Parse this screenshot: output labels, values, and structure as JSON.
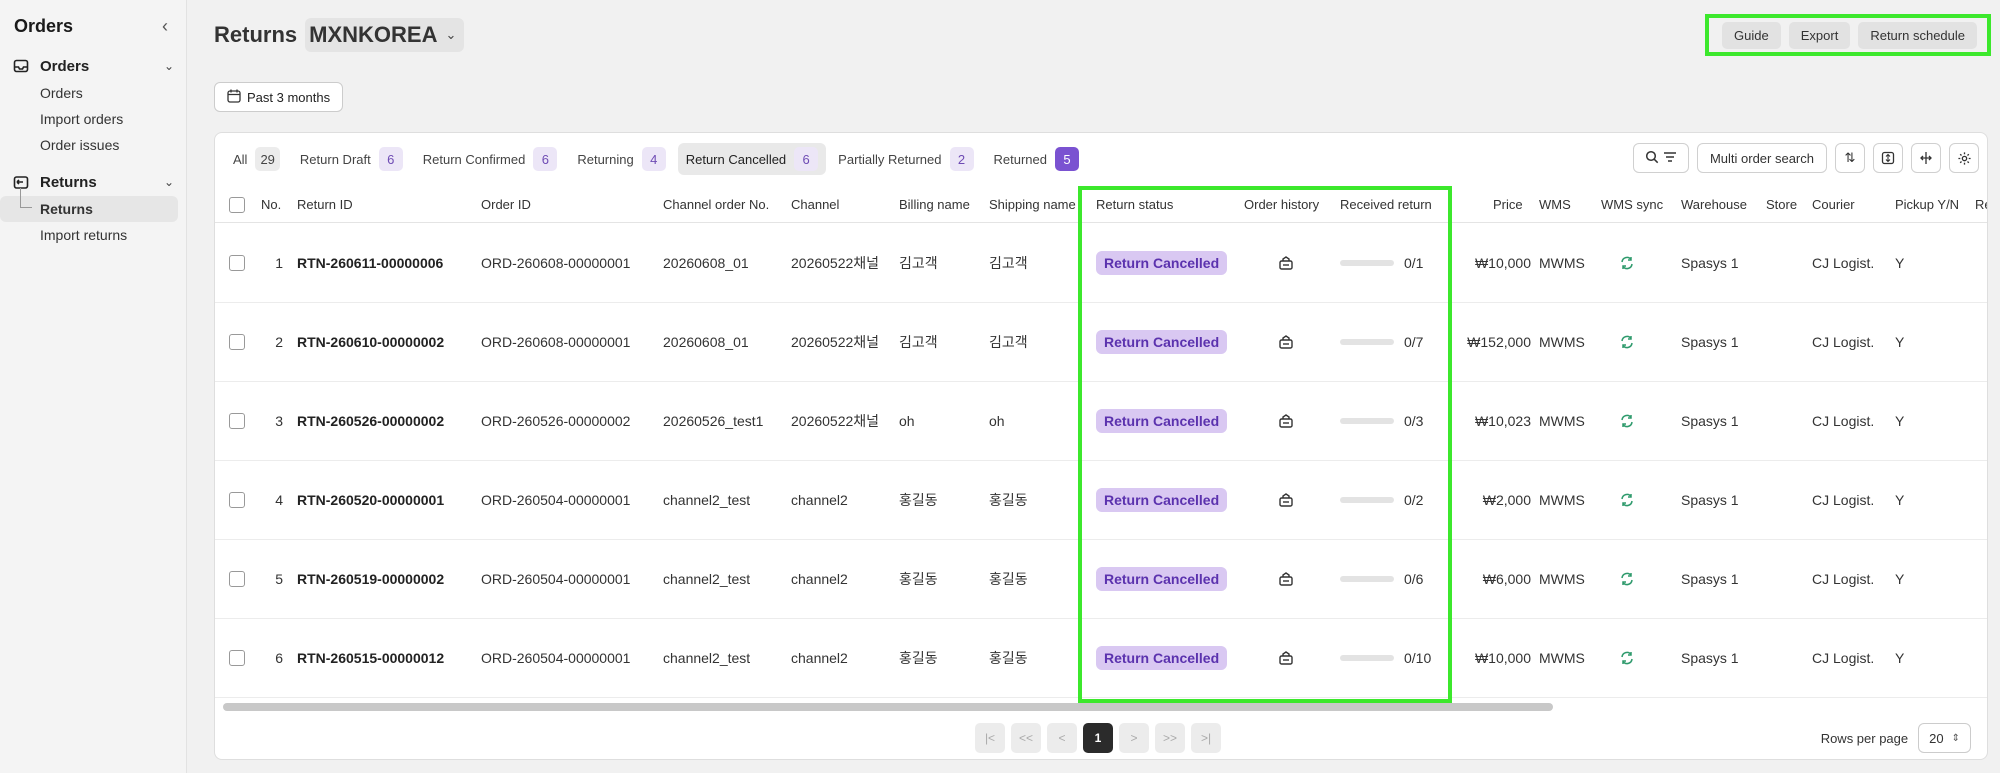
{
  "sidebar": {
    "title": "Orders",
    "sections": [
      {
        "label": "Orders",
        "items": [
          "Orders",
          "Import orders",
          "Order issues"
        ]
      },
      {
        "label": "Returns",
        "items": [
          "Returns",
          "Import returns"
        ]
      }
    ]
  },
  "header": {
    "title": "Returns",
    "store": "MXNKOREA",
    "actions": [
      "Guide",
      "Export",
      "Return schedule"
    ],
    "date_filter": "Past 3 months"
  },
  "tabs": [
    {
      "label": "All",
      "count": "29"
    },
    {
      "label": "Return Draft",
      "count": "6"
    },
    {
      "label": "Return Confirmed",
      "count": "6"
    },
    {
      "label": "Returning",
      "count": "4"
    },
    {
      "label": "Return Cancelled",
      "count": "6"
    },
    {
      "label": "Partially Returned",
      "count": "2"
    },
    {
      "label": "Returned",
      "count": "5"
    }
  ],
  "tools": {
    "multi_search": "Multi order search"
  },
  "columns": [
    "No.",
    "Return ID",
    "Order ID",
    "Channel order No.",
    "Channel",
    "Billing name",
    "Shipping name",
    "Return status",
    "Order history",
    "Received return",
    "Price",
    "WMS",
    "WMS sync",
    "Warehouse",
    "Store",
    "Courier",
    "Pickup Y/N",
    "Re"
  ],
  "rows": [
    {
      "no": "1",
      "return_id": "RTN-260611-00000006",
      "order_id": "ORD-260608-00000001",
      "channel_order": "20260608_01",
      "channel": "20260522채널",
      "billing": "김고객",
      "shipping": "김고객",
      "status": "Return Cancelled",
      "received": "0/1",
      "price": "₩10,000",
      "wms": "MWMS",
      "warehouse": "Spasys 1",
      "courier": "CJ Logist.",
      "pickup": "Y"
    },
    {
      "no": "2",
      "return_id": "RTN-260610-00000002",
      "order_id": "ORD-260608-00000001",
      "channel_order": "20260608_01",
      "channel": "20260522채널",
      "billing": "김고객",
      "shipping": "김고객",
      "status": "Return Cancelled",
      "received": "0/7",
      "price": "₩152,000",
      "wms": "MWMS",
      "warehouse": "Spasys 1",
      "courier": "CJ Logist.",
      "pickup": "Y"
    },
    {
      "no": "3",
      "return_id": "RTN-260526-00000002",
      "order_id": "ORD-260526-00000002",
      "channel_order": "20260526_test1",
      "channel": "20260522채널",
      "billing": "oh",
      "shipping": "oh",
      "status": "Return Cancelled",
      "received": "0/3",
      "price": "₩10,023",
      "wms": "MWMS",
      "warehouse": "Spasys 1",
      "courier": "CJ Logist.",
      "pickup": "Y"
    },
    {
      "no": "4",
      "return_id": "RTN-260520-00000001",
      "order_id": "ORD-260504-00000001",
      "channel_order": "channel2_test",
      "channel": "channel2",
      "billing": "홍길동",
      "shipping": "홍길동",
      "status": "Return Cancelled",
      "received": "0/2",
      "price": "₩2,000",
      "wms": "MWMS",
      "warehouse": "Spasys 1",
      "courier": "CJ Logist.",
      "pickup": "Y"
    },
    {
      "no": "5",
      "return_id": "RTN-260519-00000002",
      "order_id": "ORD-260504-00000001",
      "channel_order": "channel2_test",
      "channel": "channel2",
      "billing": "홍길동",
      "shipping": "홍길동",
      "status": "Return Cancelled",
      "received": "0/6",
      "price": "₩6,000",
      "wms": "MWMS",
      "warehouse": "Spasys 1",
      "courier": "CJ Logist.",
      "pickup": "Y"
    },
    {
      "no": "6",
      "return_id": "RTN-260515-00000012",
      "order_id": "ORD-260504-00000001",
      "channel_order": "channel2_test",
      "channel": "channel2",
      "billing": "홍길동",
      "shipping": "홍길동",
      "status": "Return Cancelled",
      "received": "0/10",
      "price": "₩10,000",
      "wms": "MWMS",
      "warehouse": "Spasys 1",
      "courier": "CJ Logist.",
      "pickup": "Y"
    }
  ],
  "pagination": {
    "buttons": [
      "|<",
      "<<",
      "<",
      "1",
      ">",
      ">>",
      ">|"
    ],
    "current": "1",
    "rows_per_page_label": "Rows per page",
    "rows_per_page": "20"
  },
  "colors": {
    "highlight": "#3ce82c",
    "status_bg": "#d9c8f2",
    "status_text": "#5b32ae"
  }
}
